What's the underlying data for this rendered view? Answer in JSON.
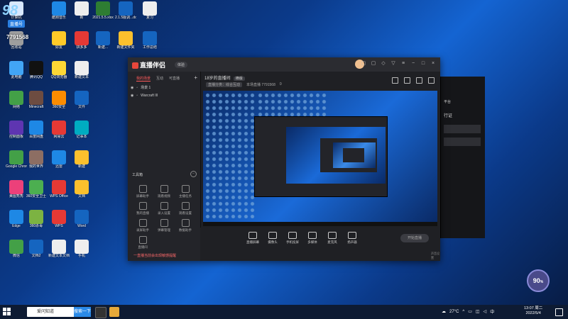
{
  "watermark": {
    "title": "98",
    "badge": "直播号",
    "number": "7791568"
  },
  "desktop": {
    "icons": [
      {
        "label": "计算机",
        "color": "#d8e8ff"
      },
      {
        "label": "酷狗音乐",
        "color": "#1e88e5"
      },
      {
        "label": "新",
        "color": "#eeeeee"
      },
      {
        "label": "2021.5.5.xlsx",
        "color": "#2e7d32"
      },
      {
        "label": "2.1.5版调...docx",
        "color": "#1565c0"
      },
      {
        "label": "复习",
        "color": "#eeeeee"
      },
      {
        "label": "回收站",
        "color": "#9e9e9e"
      },
      {
        "label": "好友",
        "color": "#ffca28"
      },
      {
        "label": "拼多多",
        "color": "#e53935"
      },
      {
        "label": "新建...",
        "color": "#1565c0"
      },
      {
        "label": "新建文件夹",
        "color": "#fbc02d"
      },
      {
        "label": "工作总结",
        "color": "#1565c0"
      },
      {
        "label": "此电脑",
        "color": "#42a5f5"
      },
      {
        "label": "腾讯QQ",
        "color": "#111"
      },
      {
        "label": "QQ浏览器",
        "color": "#fdd835"
      },
      {
        "label": "新建文本",
        "color": "#eeeeee"
      },
      {
        "label": "网络",
        "color": "#43a047"
      },
      {
        "label": "Minecraft",
        "color": "#6d4c41"
      },
      {
        "label": "360安全",
        "color": "#fb8c00"
      },
      {
        "label": "文件",
        "color": "#1565c0"
      },
      {
        "label": "控制面板",
        "color": "#5e35b1"
      },
      {
        "label": "百度网盘",
        "color": "#1e88e5"
      },
      {
        "label": "网易云",
        "color": "#e53935"
      },
      {
        "label": "记事本",
        "color": "#00acc1"
      },
      {
        "label": "Google Chrome",
        "color": "#43a047"
      },
      {
        "label": "我的世界",
        "color": "#8d6e63"
      },
      {
        "label": "迅雷",
        "color": "#1e88e5"
      },
      {
        "label": "新建",
        "color": "#fbc02d"
      },
      {
        "label": "美图秀秀",
        "color": "#ec407a"
      },
      {
        "label": "360安全卫士",
        "color": "#4caf50"
      },
      {
        "label": "WPS Office",
        "color": "#e53935"
      },
      {
        "label": "文档",
        "color": "#fbc02d"
      },
      {
        "label": "Edge",
        "color": "#1e88e5"
      },
      {
        "label": "360杀毒",
        "color": "#7cb342"
      },
      {
        "label": "WPS",
        "color": "#e53935"
      },
      {
        "label": "Word",
        "color": "#1565c0"
      },
      {
        "label": "微信",
        "color": "#43a047"
      },
      {
        "label": "文档2",
        "color": "#1565c0"
      },
      {
        "label": "新建文本文档",
        "color": "#eeeeee"
      },
      {
        "label": "手机",
        "color": "#eeeeee"
      }
    ]
  },
  "app": {
    "name": "直播伴侣",
    "version": "体验",
    "left_tabs": [
      "我的场景",
      "互动",
      "可直播"
    ],
    "scenes": [
      "场景 1",
      "Warcraft III"
    ],
    "tools_title": "工具箱",
    "tools": [
      "屏幕助手",
      "观看视频",
      "主播任务",
      "我的直播",
      "录入设置",
      "观看设置",
      "录屏助手",
      "弹幕管理",
      "数据助手",
      "直播间"
    ],
    "bottom_notice": "一直播当前会出现敏感提醒",
    "preview_title": "18岁的直播间",
    "preview_tag": "横版",
    "preview_sub_left": "直播分类：综合互动",
    "preview_sub_right": "本场直播 7791568",
    "preview_like": "0",
    "bottom_items": [
      "直播屏幕",
      "摄像头",
      "手机投屏",
      "多媒体",
      "麦克风",
      "扬声器"
    ],
    "start_button": "开始直播",
    "bottom_note": "声音设置"
  },
  "bg_window": {
    "title": "平台",
    "subtitle": "行证"
  },
  "speed": {
    "value": "90",
    "unit": "%"
  },
  "taskbar": {
    "search_placeholder": "爱问知道",
    "search_button": "搜索一下",
    "weather": "27°C",
    "time": "13:07 周二",
    "date": "2022/5/4"
  }
}
